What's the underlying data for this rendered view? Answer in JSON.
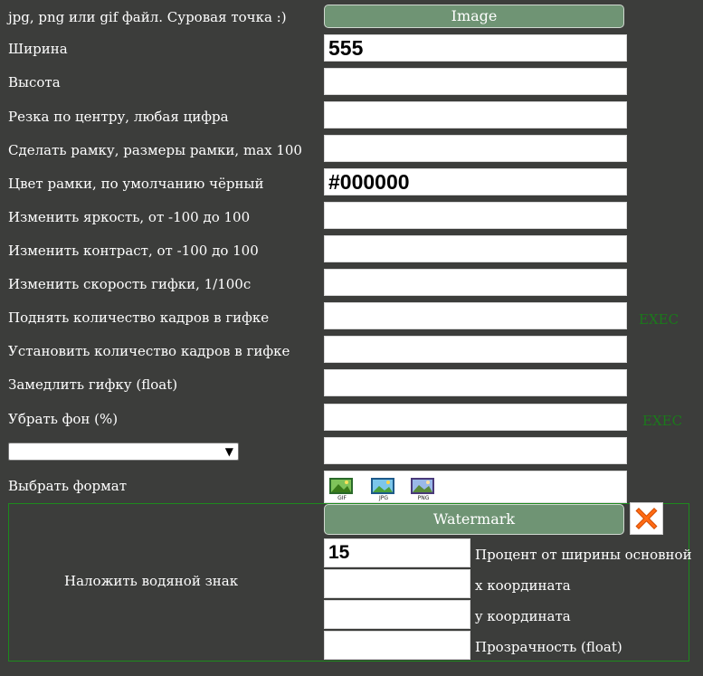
{
  "header": {
    "hint": "jpg, png или gif файл. Суровая точка :)",
    "image_button": "Image"
  },
  "rows": [
    {
      "label": "Ширина",
      "value": "555"
    },
    {
      "label": "Высота",
      "value": ""
    },
    {
      "label": "Резка по центру, любая цифра",
      "value": ""
    },
    {
      "label": "Сделать рамку, размеры рамки, max 100",
      "value": ""
    },
    {
      "label": "Цвет рамки, по умолчанию чёрный",
      "value": "#000000"
    },
    {
      "label": "Изменить яркость, от -100 до 100",
      "value": ""
    },
    {
      "label": "Изменить контраст, от -100 до 100",
      "value": ""
    },
    {
      "label": "Изменить скорость гифки, 1/100c",
      "value": ""
    },
    {
      "label": "Поднять количество кадров в гифке",
      "value": ""
    },
    {
      "label": "Установить количество кадров в гифке",
      "value": ""
    },
    {
      "label": "Замедлить гифку (float)",
      "value": ""
    },
    {
      "label": "Убрать фон (%)",
      "value": ""
    }
  ],
  "exec_links": {
    "frames": "EXEC",
    "bg": "EXEC"
  },
  "select": {
    "value": ""
  },
  "format": {
    "label": "Выбрать формат",
    "icons": [
      {
        "name": "gif-format-icon",
        "text": "GIF"
      },
      {
        "name": "jpg-format-icon",
        "text": "JPG"
      },
      {
        "name": "png-format-icon",
        "text": "PNG"
      }
    ]
  },
  "watermark": {
    "title": "Наложить водяной знак",
    "button": "Watermark",
    "fields": [
      {
        "label": "Процент от ширины основной",
        "value": "15"
      },
      {
        "label": "x координата",
        "value": ""
      },
      {
        "label": "y координата",
        "value": ""
      },
      {
        "label": "Прозрачность (float)",
        "value": ""
      }
    ]
  },
  "colors": {
    "background": "#3c3d3b",
    "button": "#6f9474",
    "exec": "#1b7a1b",
    "border": "#1d8a1d",
    "close": "#ff6a13"
  }
}
